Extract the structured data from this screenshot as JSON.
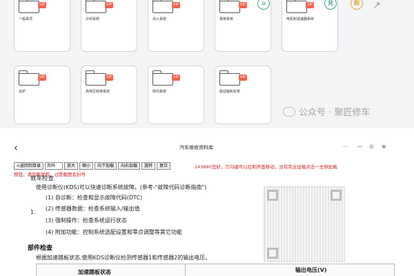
{
  "folder_grid": {
    "badge_text": "VIP",
    "tiles": [
      {
        "label": "一般事项"
      },
      {
        "label": "冷却系统"
      },
      {
        "label": "点火系统"
      },
      {
        "label": "悬架系统"
      },
      {
        "label": "电机和减速器系统"
      },
      {
        "label": "遥护"
      },
      {
        "label": "高电压转换系统"
      },
      {
        "label": "转向系统"
      },
      {
        "label": "驱动轴和车桥"
      }
    ],
    "round_icons": [
      {
        "name": "home",
        "glyph": "⌂",
        "color": "#3aa07a"
      },
      {
        "name": "exchange",
        "glyph": "兑",
        "color": "#3aa07a"
      },
      {
        "name": "purchase",
        "glyph": "购",
        "color": "#e0a43b"
      }
    ],
    "watermark": "公众号 · 聚匠修车"
  },
  "viewer": {
    "title": "汽车维修资料库",
    "window_controls": [
      "⋯",
      "—",
      "⊙",
      "⊗"
    ],
    "toolbar": {
      "back_to_index": "<返回到目录",
      "page_select": "页码",
      "zoom_in": "放大",
      "zoom_out": "缩小",
      "load_down": "向下加载",
      "load_up": "向右加载",
      "rotate": "旋转",
      "reset": "复位"
    },
    "notice_line1": "243890您好，方向键可以控制界面移动，没有完全加载点击一左侧加载",
    "notice_line2": "按钮，请勿截屏和，过度截图会封号"
  },
  "document": {
    "section_title_partial": "就车检查",
    "intro": "使用诊断仪(KDS)可以快速诊断系统故障。(参考-\"故障代码诊断指南\")",
    "list_marker": "1.",
    "items": [
      "(1) 自诊断：检查和显示故障代码(DTC)",
      "(2) 传感器数据：检查系统输入/输出值",
      "(3) 强制操作：检查系统运行状态",
      "(4) 附加功能：控制系统选配设置和零点调整等其它功能"
    ],
    "component_heading": "部件检查",
    "component_text": "根据加速踏板状态,使用KDS诊断仪检测传感器1和传感器2的输出电压。",
    "table_headers": [
      "加速踏板状态",
      "输出电压(V)"
    ]
  }
}
